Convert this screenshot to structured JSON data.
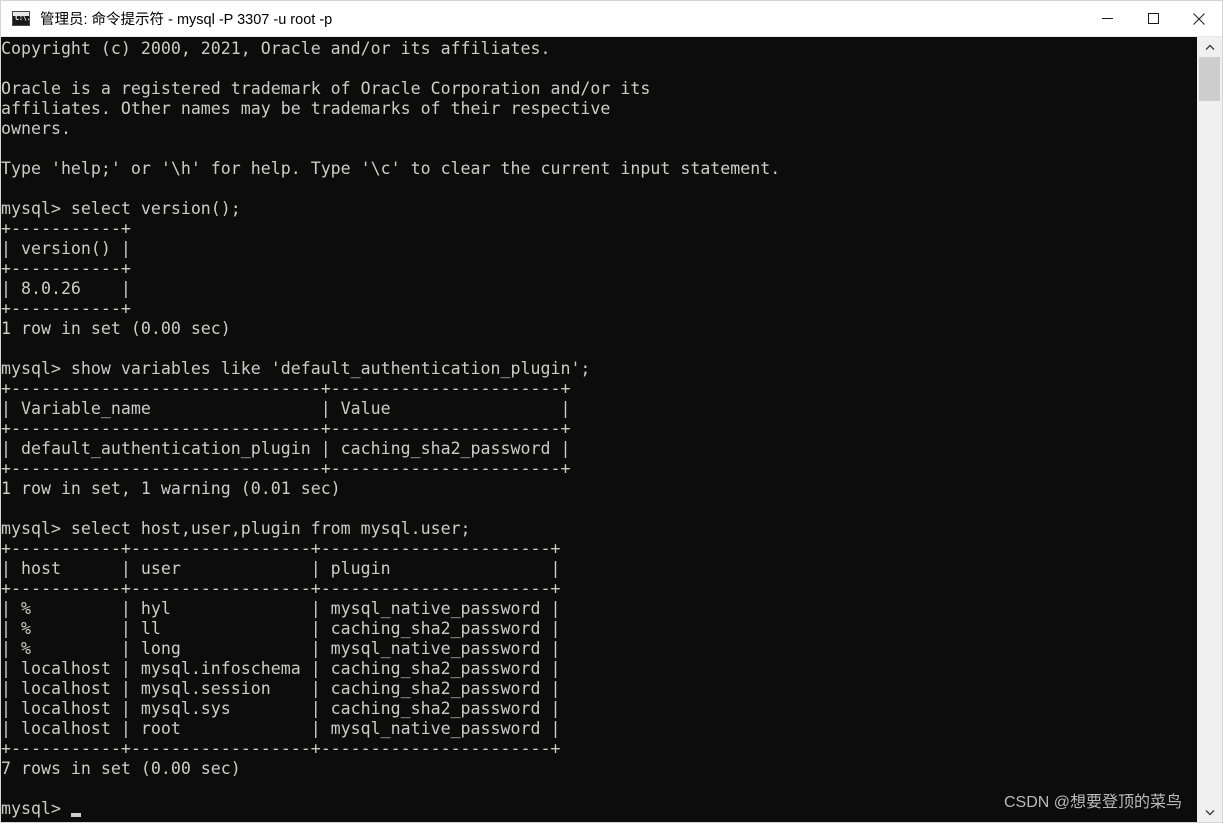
{
  "window": {
    "title": "管理员: 命令提示符 - mysql  -P 3307 -u root -p",
    "icon_name": "cmd-console-icon",
    "icon_glyph": "C:\\.",
    "controls": {
      "minimize_label": "Minimize",
      "maximize_label": "Maximize",
      "close_label": "Close"
    }
  },
  "terminal": {
    "background_color": "#0c0c0c",
    "foreground_color": "#ccccc7",
    "content": "Copyright (c) 2000, 2021, Oracle and/or its affiliates.\n\nOracle is a registered trademark of Oracle Corporation and/or its\naffiliates. Other names may be trademarks of their respective\nowners.\n\nType 'help;' or '\\h' for help. Type '\\c' to clear the current input statement.\n\nmysql> select version();\n+-----------+\n| version() |\n+-----------+\n| 8.0.26    |\n+-----------+\n1 row in set (0.00 sec)\n\nmysql> show variables like 'default_authentication_plugin';\n+-------------------------------+-----------------------+\n| Variable_name                 | Value                 |\n+-------------------------------+-----------------------+\n| default_authentication_plugin | caching_sha2_password |\n+-------------------------------+-----------------------+\n1 row in set, 1 warning (0.01 sec)\n\nmysql> select host,user,plugin from mysql.user;\n+-----------+------------------+-----------------------+\n| host      | user             | plugin                |\n+-----------+------------------+-----------------------+\n| %         | hyl              | mysql_native_password |\n| %         | ll               | caching_sha2_password |\n| %         | long             | mysql_native_password |\n| localhost | mysql.infoschema | caching_sha2_password |\n| localhost | mysql.session    | caching_sha2_password |\n| localhost | mysql.sys        | caching_sha2_password |\n| localhost | root             | mysql_native_password |\n+-----------+------------------+-----------------------+\n7 rows in set (0.00 sec)\n\nmysql>",
    "prompt": "mysql>",
    "cursor_visible": true,
    "sessions": [
      {
        "command": "select version();",
        "columns": [
          "version()"
        ],
        "rows": [
          [
            "8.0.26"
          ]
        ],
        "status": "1 row in set (0.00 sec)"
      },
      {
        "command": "show variables like 'default_authentication_plugin';",
        "columns": [
          "Variable_name",
          "Value"
        ],
        "rows": [
          [
            "default_authentication_plugin",
            "caching_sha2_password"
          ]
        ],
        "status": "1 row in set, 1 warning (0.01 sec)"
      },
      {
        "command": "select host,user,plugin from mysql.user;",
        "columns": [
          "host",
          "user",
          "plugin"
        ],
        "rows": [
          [
            "%",
            "hyl",
            "mysql_native_password"
          ],
          [
            "%",
            "ll",
            "caching_sha2_password"
          ],
          [
            "%",
            "long",
            "mysql_native_password"
          ],
          [
            "localhost",
            "mysql.infoschema",
            "caching_sha2_password"
          ],
          [
            "localhost",
            "mysql.session",
            "caching_sha2_password"
          ],
          [
            "localhost",
            "mysql.sys",
            "caching_sha2_password"
          ],
          [
            "localhost",
            "root",
            "mysql_native_password"
          ]
        ],
        "status": "7 rows in set (0.00 sec)"
      }
    ],
    "banner": [
      "Copyright (c) 2000, 2021, Oracle and/or its affiliates.",
      "Oracle is a registered trademark of Oracle Corporation and/or its affiliates. Other names may be trademarks of their respective owners.",
      "Type 'help;' or '\\h' for help. Type '\\c' to clear the current input statement."
    ]
  },
  "watermark": {
    "text": "CSDN @想要登顶的菜鸟"
  },
  "scrollbar": {
    "up_arrow_name": "scroll-up-arrow",
    "down_arrow_name": "scroll-down-arrow",
    "thumb_name": "scroll-thumb"
  }
}
